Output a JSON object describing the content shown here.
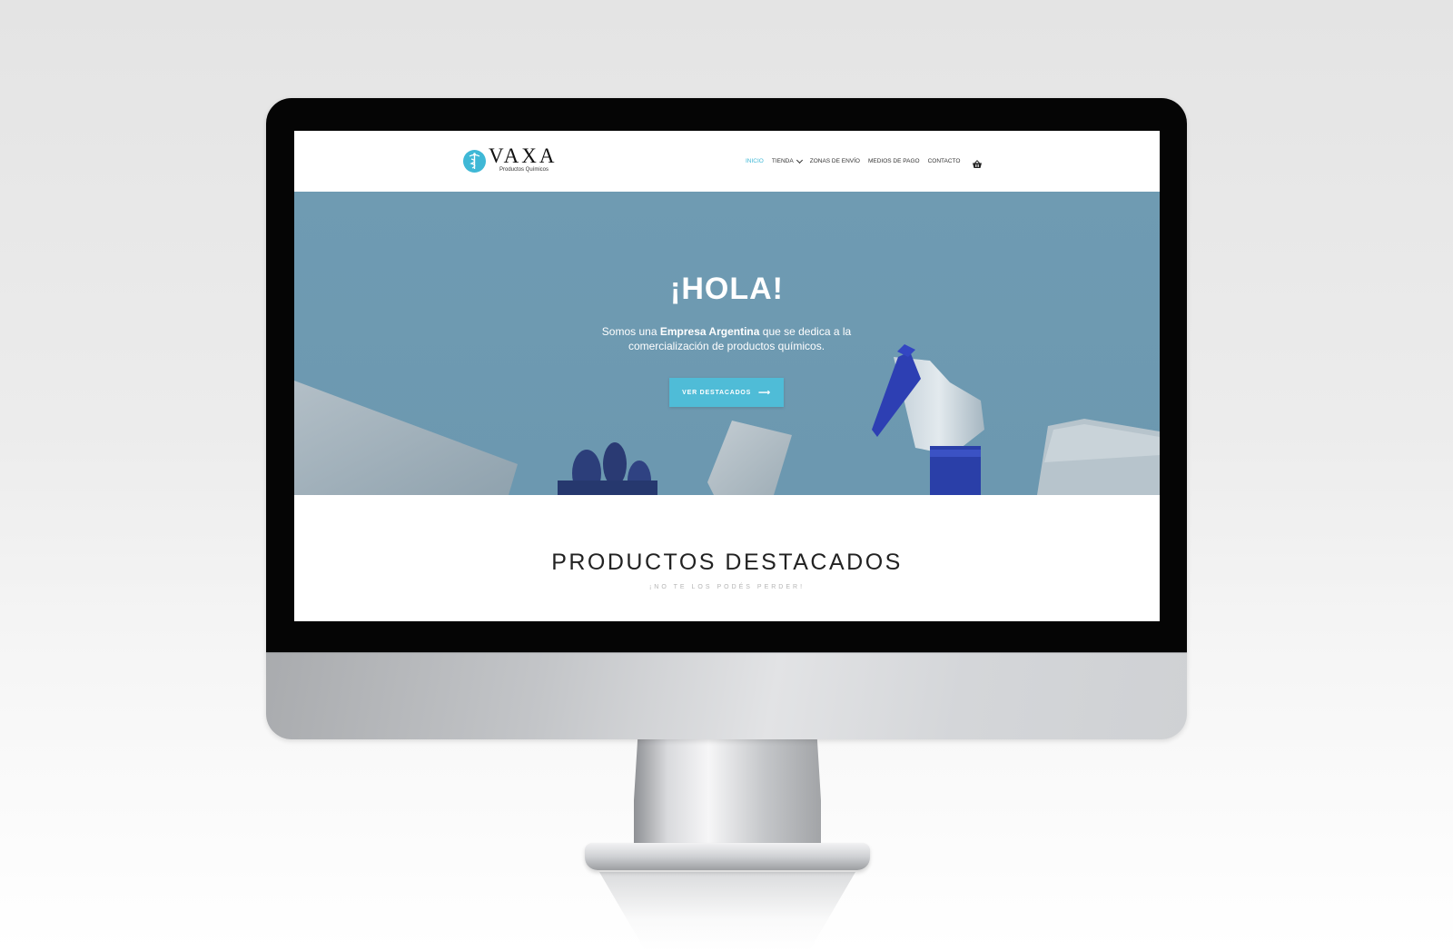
{
  "brand": {
    "name": "VAXA",
    "tagline": "Productos Químicos",
    "accent": "#3fb8d6"
  },
  "nav": {
    "items": [
      {
        "label": "INICIO",
        "active": true
      },
      {
        "label": "TIENDA",
        "has_dropdown": true
      },
      {
        "label": "ZONAS DE ENVÍO"
      },
      {
        "label": "MEDIOS DE PAGO"
      },
      {
        "label": "CONTACTO"
      }
    ],
    "cart_icon": "cart-basket-icon"
  },
  "hero": {
    "title": "¡HOLA!",
    "text_before": "Somos una ",
    "text_bold": "Empresa Argentina",
    "text_after": " que se dedica a la comercialización de productos químicos.",
    "button_label": "VER DESTACADOS",
    "button_icon": "arrow-right-icon",
    "background_color": "#6f9bb2"
  },
  "featured": {
    "title": "PRODUCTOS DESTACADOS",
    "subtitle": "¡NO TE LOS PODÉS PERDER!"
  }
}
